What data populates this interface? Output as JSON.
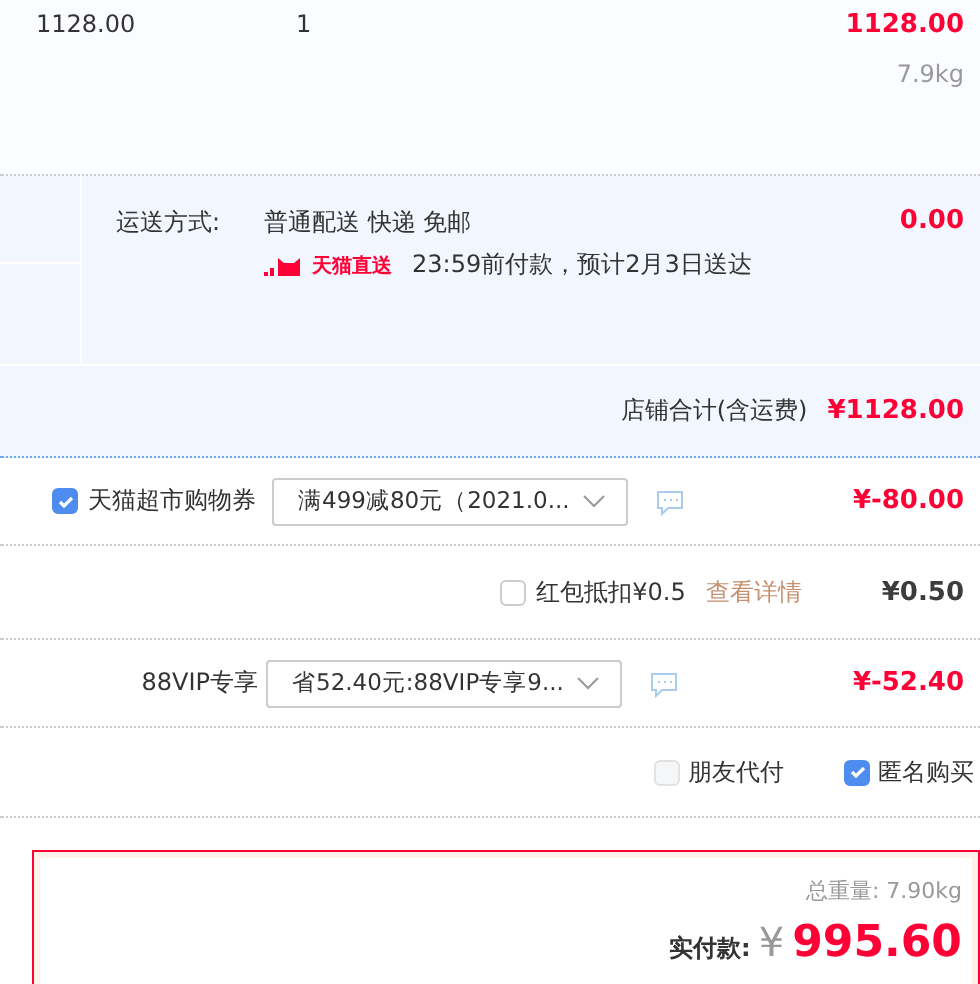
{
  "item": {
    "price": "1128.00",
    "quantity": "1",
    "subtotal": "1128.00",
    "weight": "7.9kg"
  },
  "shipping": {
    "label": "运送方式:",
    "method": "普通配送 快递 免邮",
    "badge": "天猫直送",
    "eta": "23:59前付款，预计2月3日送达",
    "fee": "0.00"
  },
  "store_total": {
    "label": "店铺合计(含运费)",
    "amount": "¥1128.00"
  },
  "discounts": [
    {
      "kind": "select",
      "label": "天猫超市购物券",
      "checked": true,
      "value": "满499减80元（2021.0...",
      "amount": "¥-80.00",
      "negative": true
    },
    {
      "kind": "check",
      "label": "红包抵扣¥0.5",
      "checked": false,
      "link": "查看详情",
      "amount": "¥0.50",
      "negative": false
    },
    {
      "kind": "select",
      "label": "88VIP专享",
      "value": "省52.40元:88VIP专享9...",
      "amount": "¥-52.40",
      "negative": true
    }
  ],
  "options": [
    {
      "label": "朋友代付",
      "checked": false,
      "disabled": true
    },
    {
      "label": "匿名购买",
      "checked": true,
      "disabled": false
    }
  ],
  "summary": {
    "weight_label": "总重量:",
    "weight": "7.90kg",
    "pay_label": "实付款:",
    "currency": "¥",
    "total": "995.60"
  }
}
